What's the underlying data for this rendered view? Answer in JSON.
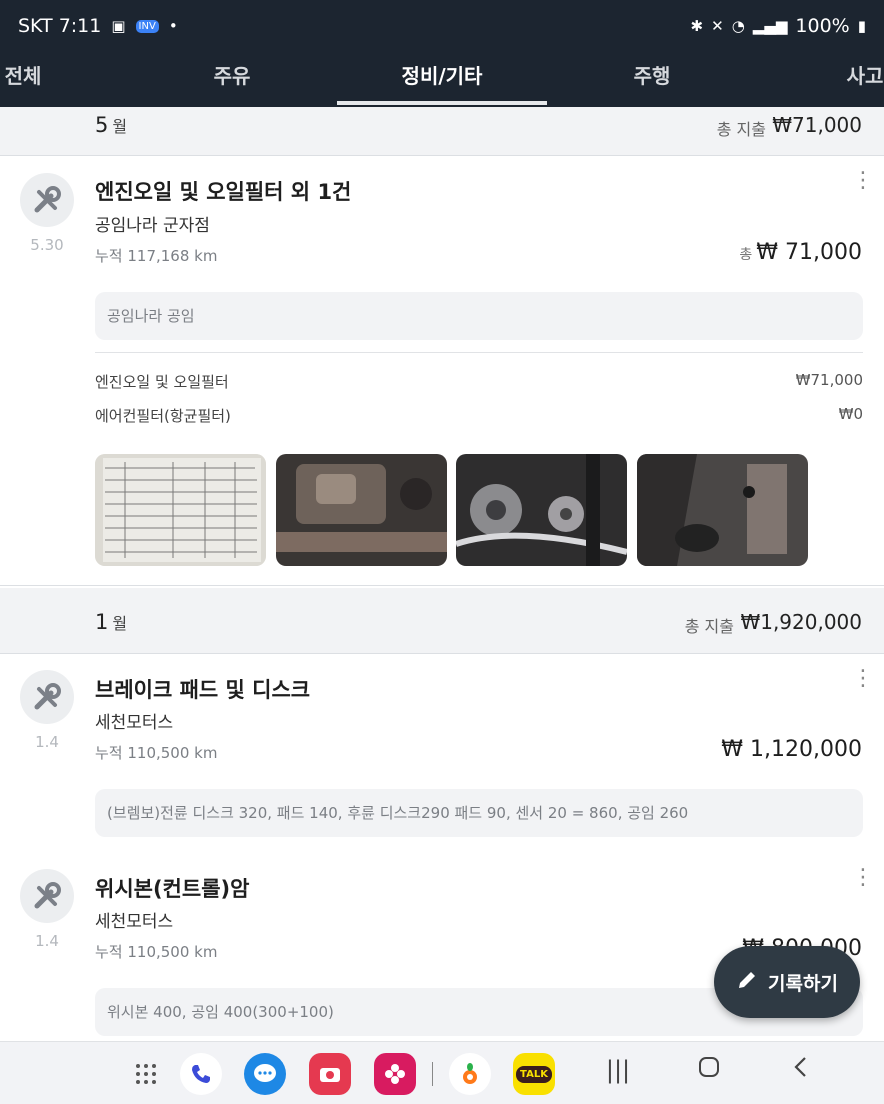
{
  "status_bar": {
    "carrier_time": "SKT 7:11",
    "app_badge": "INV",
    "battery": "100%"
  },
  "tabs": [
    {
      "label": "전체",
      "active": false
    },
    {
      "label": "주유",
      "active": false
    },
    {
      "label": "정비/기타",
      "active": true
    },
    {
      "label": "주행",
      "active": false
    },
    {
      "label": "사고",
      "active": false
    }
  ],
  "months": [
    {
      "num": "5",
      "unit": "월",
      "total_label": "총 지출",
      "total": "₩71,000",
      "entries": [
        {
          "icon": "wrench-screwdriver-icon",
          "date": "5.30",
          "title": "엔진오일 및 오일필터 외 1건",
          "shop": "공임나라 군자점",
          "odometer": "누적 117,168 km",
          "amount_prefix": "총",
          "amount": "₩ 71,000",
          "memo": "공임나라 공임",
          "items": [
            {
              "name": "엔진오일 및 오일필터",
              "price": "₩71,000"
            },
            {
              "name": "에어컨필터(항균필터)",
              "price": "₩0"
            }
          ],
          "photos": [
            "receipt-photo",
            "engine-photo-1",
            "engine-photo-2",
            "engine-photo-3"
          ]
        }
      ]
    },
    {
      "num": "1",
      "unit": "월",
      "total_label": "총 지출",
      "total": "₩1,920,000",
      "entries": [
        {
          "icon": "wrench-screwdriver-icon",
          "date": "1.4",
          "title": "브레이크 패드 및 디스크",
          "shop": "세천모터스",
          "odometer": "누적 110,500 km",
          "amount": "₩ 1,120,000",
          "memo": "(브렘보)전륜 디스크 320, 패드 140, 후륜 디스크290 패드 90, 센서 20 = 860, 공임 260"
        },
        {
          "icon": "wrench-screwdriver-icon",
          "date": "1.4",
          "title": "위시본(컨트롤)암",
          "shop": "세천모터스",
          "odometer": "누적 110,500 km",
          "amount": "₩ 800,000",
          "memo": "위시본 400, 공임 400(300+100)"
        }
      ]
    }
  ],
  "fab": {
    "label": "기록하기",
    "icon": "pencil-icon"
  },
  "navbar": {
    "apps": [
      "app-drawer-icon",
      "phone-icon",
      "messages-icon",
      "camera-icon",
      "gallery-icon",
      "carrot-app-icon",
      "kakaotalk-icon"
    ],
    "kakao_label": "TALK",
    "system": [
      "recents-icon",
      "home-icon",
      "back-icon"
    ],
    "colors": {
      "status": "#1c2530",
      "fab": "#2f3a44",
      "messages": "#1e88e5",
      "camera": "#e53950",
      "gallery": "#d81b60",
      "kakao": "#f9e000"
    }
  }
}
